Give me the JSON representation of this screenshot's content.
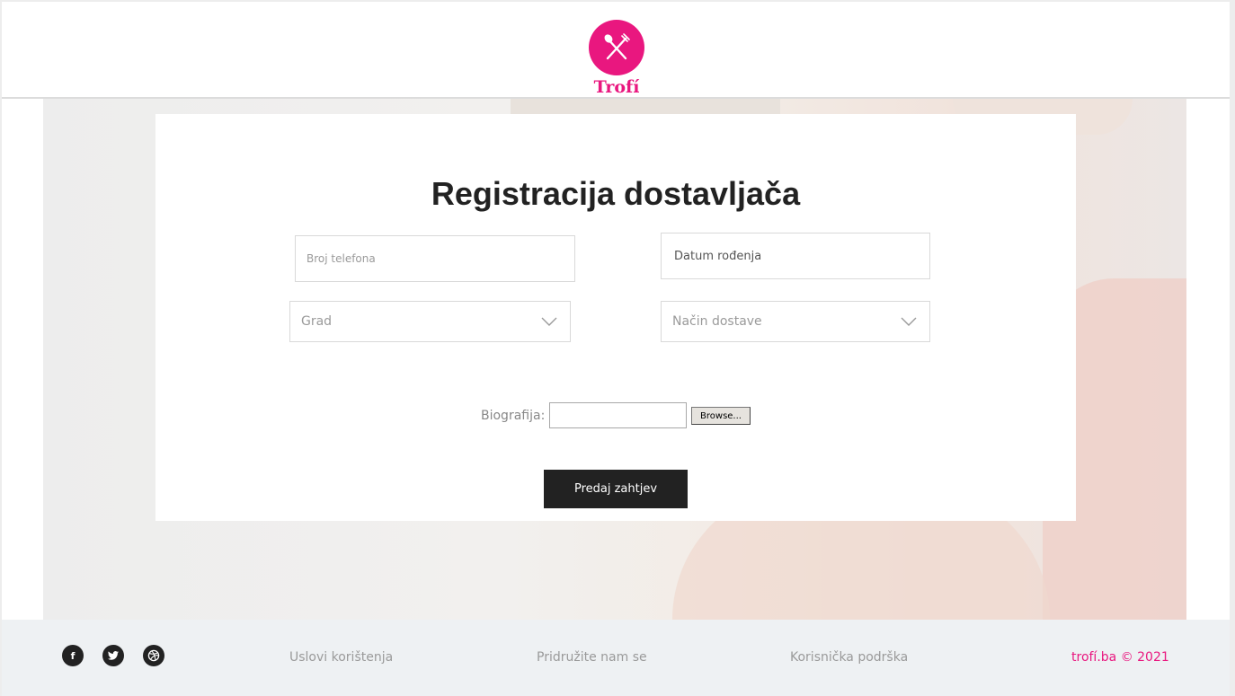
{
  "header": {
    "logo_text": "Trofí"
  },
  "form": {
    "title": "Registracija dostavljača",
    "phone_placeholder": "Broj telefona",
    "birthdate_placeholder": "Datum rođenja",
    "city_select": "Grad",
    "delivery_select": "Način dostave",
    "bio_label": "Biografija:",
    "browse_label": "Browse...",
    "submit_label": "Predaj zahtjev"
  },
  "footer": {
    "social": [
      {
        "icon": "facebook-icon",
        "glyph": "f"
      },
      {
        "icon": "twitter-icon",
        "glyph": "🐦"
      },
      {
        "icon": "dribbble-icon",
        "glyph": "◎"
      }
    ],
    "links": [
      "Uslovi korištenja",
      "Pridružite nam se",
      "Korisnička podrška"
    ],
    "copyright": "trofí.ba © 2021"
  },
  "colors": {
    "brand": "#e9177f",
    "button": "#222222",
    "footer_bg": "#eef1f3"
  }
}
